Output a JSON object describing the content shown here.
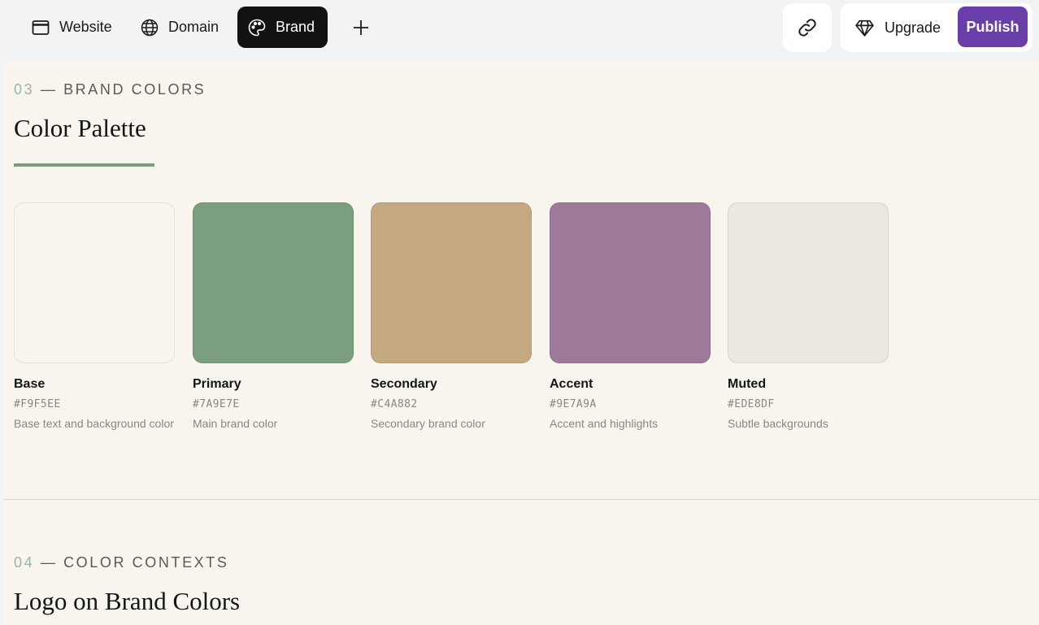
{
  "nav": {
    "tabs": [
      {
        "label": "Website",
        "icon": "browser-window-icon"
      },
      {
        "label": "Domain",
        "icon": "globe-icon"
      },
      {
        "label": "Brand",
        "icon": "palette-icon",
        "active": true
      }
    ],
    "add_icon": "plus-icon",
    "link_icon": "link-icon",
    "upgrade_label": "Upgrade",
    "upgrade_icon": "diamond-icon",
    "publish_label": "Publish"
  },
  "section3": {
    "number": "03",
    "separator": "—",
    "eyebrow": "BRAND COLORS",
    "title": "Color Palette",
    "swatches": [
      {
        "name": "Base",
        "hex": "#F9F5EE",
        "description": "Base text and background color",
        "color": "#F9F5EE"
      },
      {
        "name": "Primary",
        "hex": "#7A9E7E",
        "description": "Main brand color",
        "color": "#7A9E7E"
      },
      {
        "name": "Secondary",
        "hex": "#C4A882",
        "description": "Secondary brand color",
        "color": "#C4A882"
      },
      {
        "name": "Accent",
        "hex": "#9E7A9A",
        "description": "Accent and highlights",
        "color": "#9E7A9A"
      },
      {
        "name": "Muted",
        "hex": "#EDE8DF",
        "description": "Subtle backgrounds",
        "color": "#EDE8DF"
      }
    ]
  },
  "section4": {
    "number": "04",
    "separator": "—",
    "eyebrow": "COLOR CONTEXTS",
    "title": "Logo on Brand Colors"
  },
  "colors": {
    "publish_bg": "#6A3EA8",
    "active_tab_bg": "#121212",
    "accent_underline": "#7A9E7E",
    "page_bg": "#F8F4EE"
  }
}
